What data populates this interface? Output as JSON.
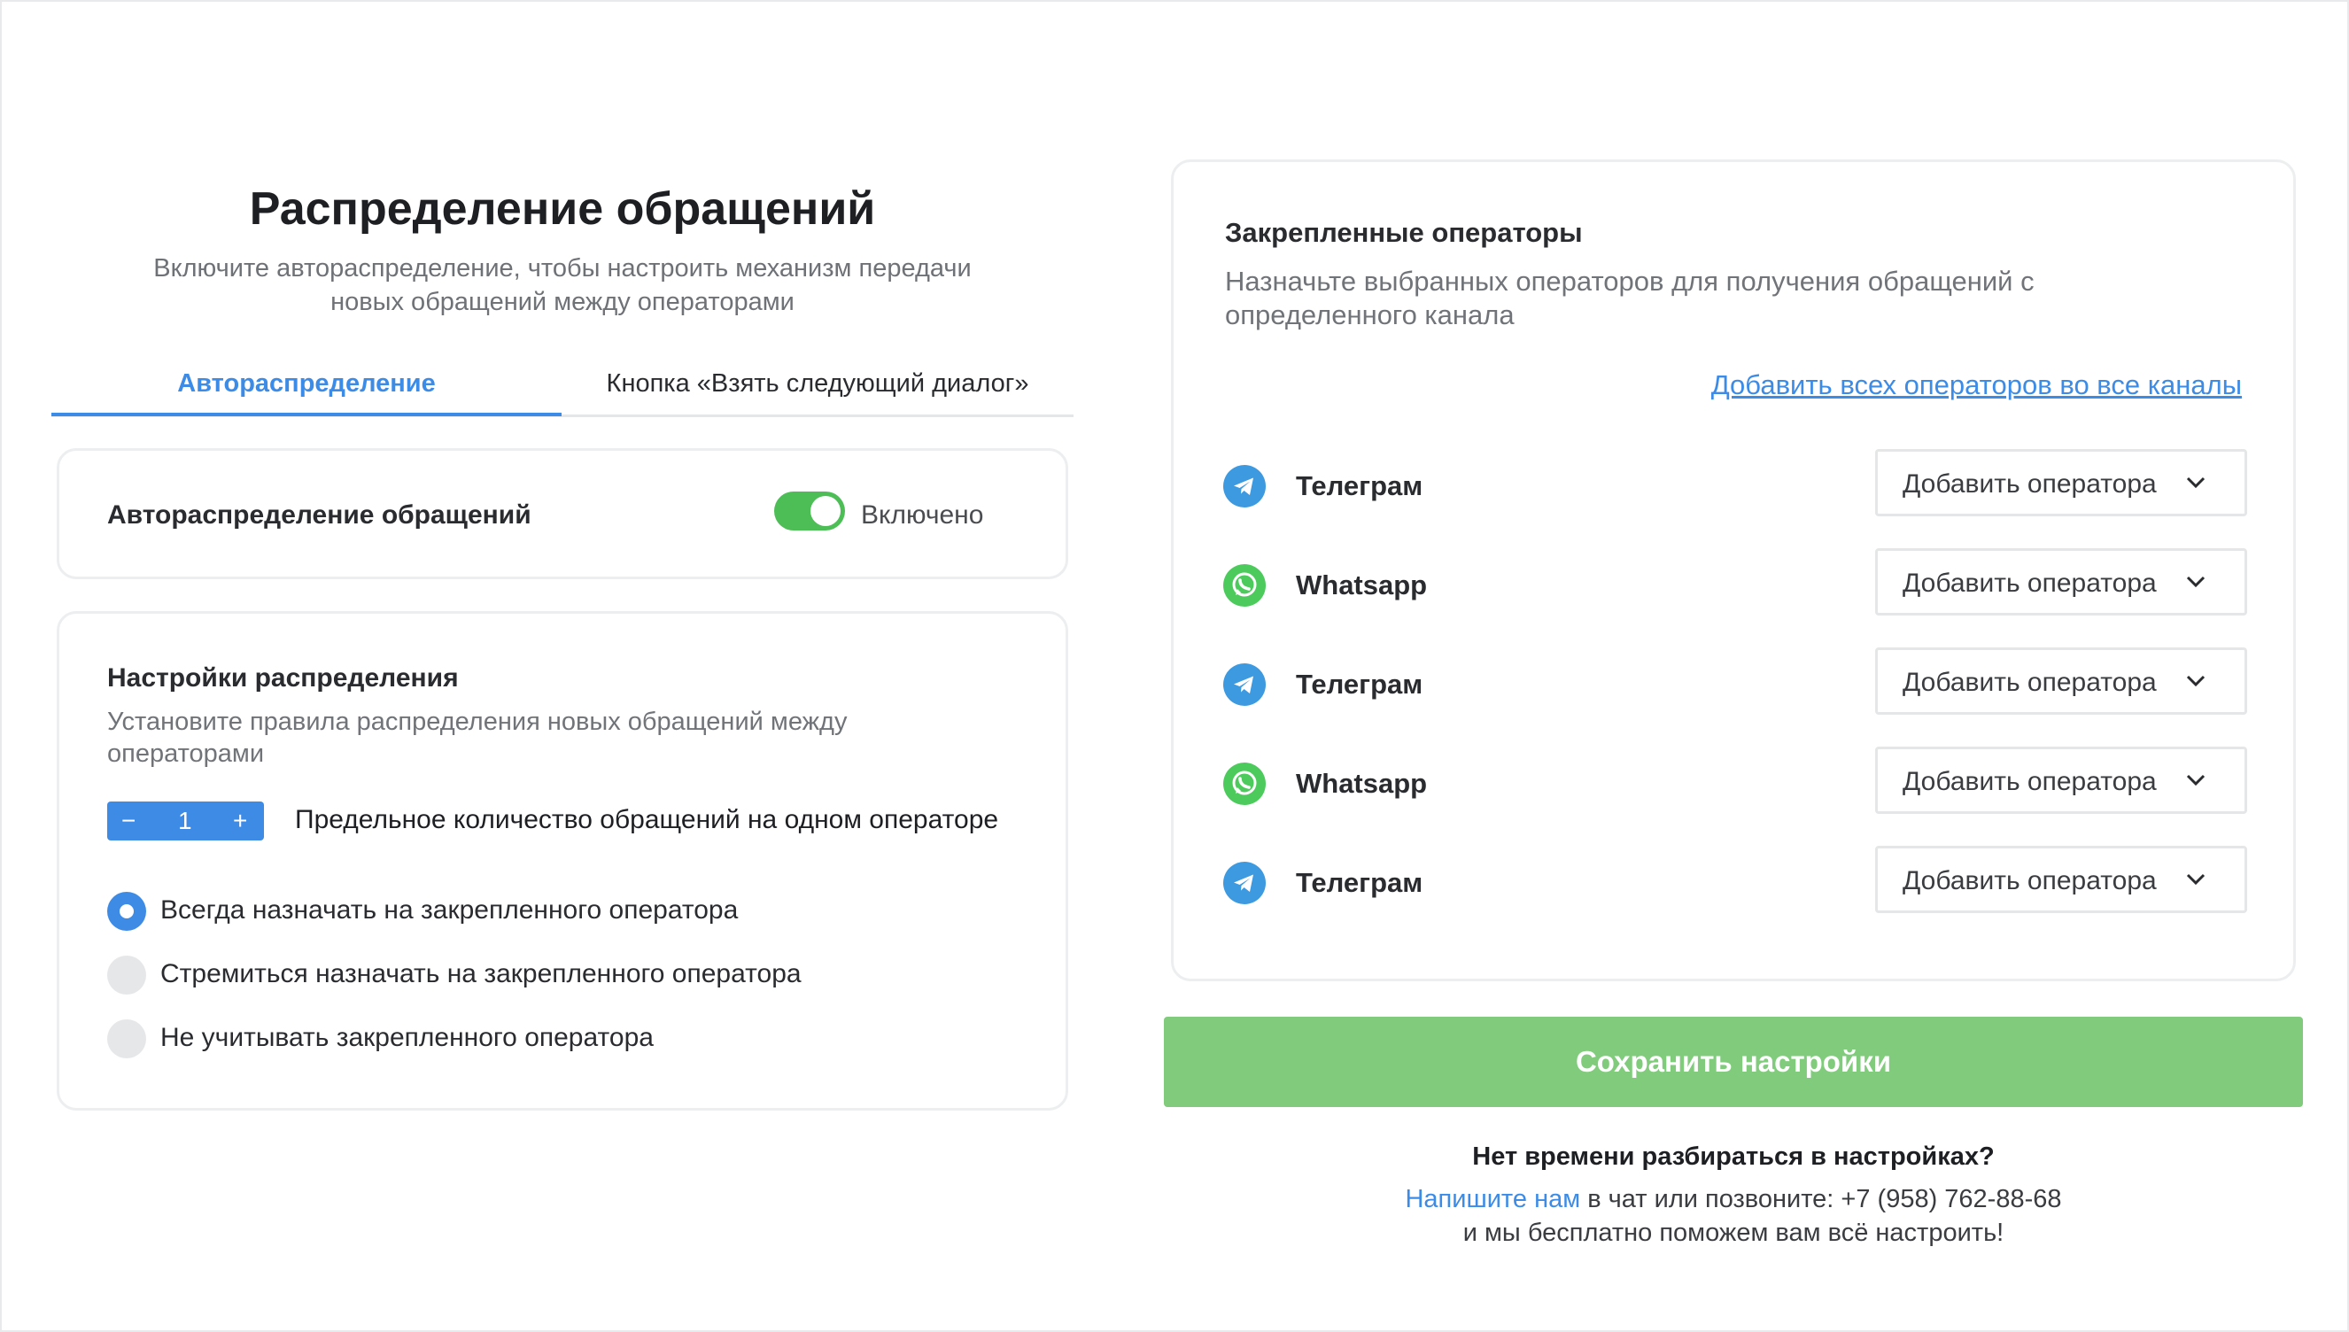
{
  "header": {
    "title": "Распределение обращений",
    "subtitle_line1": "Включите автораспределение, чтобы настроить механизм передачи",
    "subtitle_line2": "новых обращений между операторами"
  },
  "tabs": [
    {
      "label": "Автораспределение",
      "active": true
    },
    {
      "label": "Кнопка «Взять следующий диалог»",
      "active": false
    }
  ],
  "autodistribution": {
    "label": "Автораспределение обращений",
    "enabled": true,
    "state_label": "Включено"
  },
  "settings": {
    "title": "Настройки распределения",
    "desc_line1": "Установите правила распределения новых обращений между",
    "desc_line2": "операторами",
    "stepper": {
      "minus": "−",
      "value": "1",
      "plus": "+"
    },
    "limit_label": "Предельное количество обращений на одном операторе",
    "options": [
      {
        "label": "Всегда назначать на закрепленного оператора",
        "checked": true
      },
      {
        "label": "Стремиться назначать на закрепленного оператора",
        "checked": false
      },
      {
        "label": "Не учитывать закрепленного оператора",
        "checked": false
      }
    ]
  },
  "pinned": {
    "title": "Закрепленные операторы",
    "desc_line1": "Назначьте выбранных операторов для получения обращений с",
    "desc_line2": "определенного канала",
    "add_all_link": "Добавить всех операторов во все каналы",
    "channels": [
      {
        "name": "Телеграм",
        "icon": "telegram-icon",
        "select": "Добавить оператора"
      },
      {
        "name": "Whatsapp",
        "icon": "whatsapp-icon",
        "select": "Добавить оператора"
      },
      {
        "name": "Телеграм",
        "icon": "telegram-icon",
        "select": "Добавить оператора"
      },
      {
        "name": "Whatsapp",
        "icon": "whatsapp-icon",
        "select": "Добавить оператора"
      },
      {
        "name": "Телеграм",
        "icon": "telegram-icon",
        "select": "Добавить оператора"
      }
    ]
  },
  "save_button": "Сохранить настройки",
  "help": {
    "title": "Нет времени разбираться в настройках?",
    "link": "Напишите нам",
    "line1_rest": " в чат или позвоните: +7 (958) 762-88-68",
    "line2": "и мы бесплатно поможем вам всё настроить!"
  },
  "colors": {
    "accent": "#3c8ce7",
    "toggle_on": "#4cbe55",
    "save_button": "#80cc7c",
    "telegram": "#3d9ae0",
    "whatsapp": "#4ccb5c"
  }
}
